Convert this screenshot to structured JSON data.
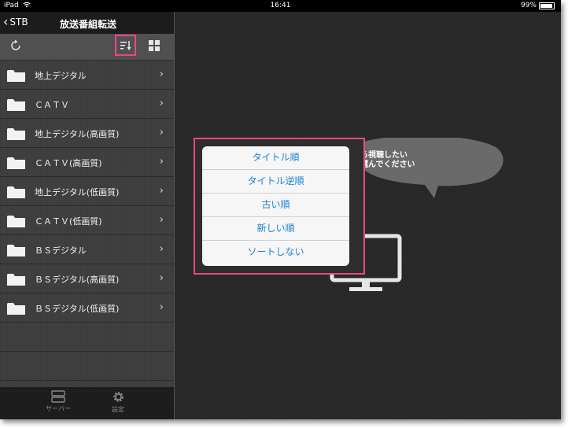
{
  "status_bar": {
    "device": "iPad",
    "time": "16:41",
    "battery": "99%"
  },
  "nav": {
    "back_label": "STB",
    "title": "放送番組転送"
  },
  "folders": [
    {
      "label": "地上デジタル"
    },
    {
      "label": "ＣＡＴＶ"
    },
    {
      "label": "地上デジタル(高画質)"
    },
    {
      "label": "ＣＡＴＶ(高画質)"
    },
    {
      "label": "地上デジタル(低画質)"
    },
    {
      "label": "ＣＡＴＶ(低画質)"
    },
    {
      "label": "ＢＳデジタル"
    },
    {
      "label": "ＢＳデジタル(高画質)"
    },
    {
      "label": "ＢＳデジタル(低画質)"
    }
  ],
  "tabs": [
    {
      "label": "サーバー",
      "icon": "server-icon"
    },
    {
      "label": "設定",
      "icon": "gear-icon"
    }
  ],
  "main": {
    "prompt_line1": "から視聴したい",
    "prompt_line2": "を選んでください"
  },
  "sort_menu": [
    {
      "label": "タイトル順"
    },
    {
      "label": "タイトル逆順"
    },
    {
      "label": "古い順"
    },
    {
      "label": "新しい順"
    },
    {
      "label": "ソートしない"
    }
  ],
  "colors": {
    "highlight": "#e8478a",
    "menu_text": "#1b82d4"
  }
}
